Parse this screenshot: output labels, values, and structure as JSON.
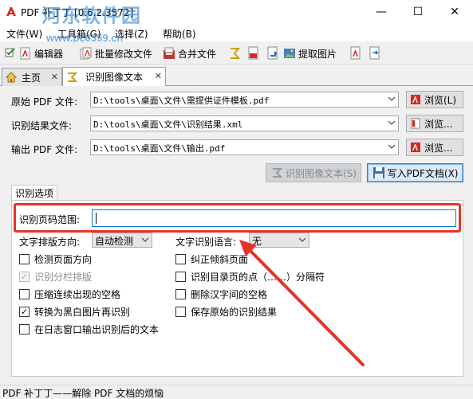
{
  "window": {
    "title": "PDF 补丁丁 [0.6.2.3572]",
    "watermark_text": "河东软件园",
    "watermark_url": "www.pc0359.cn",
    "minimize_glyph": "—",
    "maximize_glyph": "☐",
    "close_glyph": "✕"
  },
  "menu": {
    "items": [
      "文件(W)",
      "工具箱(G)",
      "选择(Z)",
      "帮助(B)"
    ]
  },
  "toolbar": {
    "editor_label": "编辑器",
    "batch_modify_label": "批量修改文件",
    "merge_label": "合并文件",
    "extract_images_label": "提取图片"
  },
  "tabs": {
    "home_label": "主页",
    "ocr_label": "识别图像文本"
  },
  "form": {
    "source_pdf_label": "原始 PDF 文件:",
    "source_pdf_value": "D:\\tools\\桌面\\文件\\需提供证件模板.pdf",
    "result_label": "识别结果文件:",
    "result_value": "D:\\tools\\桌面\\文件\\识别结果.xml",
    "output_pdf_label": "输出 PDF 文件:",
    "output_pdf_value": "D:\\tools\\桌面\\文件\\输出.pdf",
    "browse_label_1": "浏览(L)",
    "browse_label_2": "浏览...",
    "browse_label_3": "浏览...",
    "ocr_button_label": "识别图像文本(S)",
    "write_pdf_button_label": "写入PDF文档(X)"
  },
  "options": {
    "group_title": "识别选项",
    "page_range_label": "识别页码范围:",
    "page_range_value": "",
    "text_direction_label": "文字排版方向:",
    "text_direction_value": "自动检测",
    "ocr_language_label": "文字识别语言:",
    "ocr_language_value": "无",
    "checkboxes": [
      {
        "label": "检测页面方向",
        "checked": false,
        "disabled": false
      },
      {
        "label": "纠正倾斜页面",
        "checked": false,
        "disabled": false
      },
      {
        "label": "识别分栏排版",
        "checked": true,
        "disabled": true
      },
      {
        "label": "识别目录页的点（……）分隔符",
        "checked": false,
        "disabled": false
      },
      {
        "label": "压缩连续出现的空格",
        "checked": false,
        "disabled": false
      },
      {
        "label": "删除汉字间的空格",
        "checked": false,
        "disabled": false
      },
      {
        "label": "转换为黑白图片再识别",
        "checked": true,
        "disabled": false
      },
      {
        "label": "保存原始的识别结果",
        "checked": false,
        "disabled": false
      },
      {
        "label": "在日志窗口输出识别后的文本",
        "checked": false,
        "disabled": false
      }
    ]
  },
  "status": {
    "text": "PDF 补丁丁——解除 PDF 文档的烦恼"
  },
  "colors": {
    "highlight_red": "#e6332a",
    "focus_blue": "#0078d7",
    "watermark_blue": "#1a77c9"
  }
}
